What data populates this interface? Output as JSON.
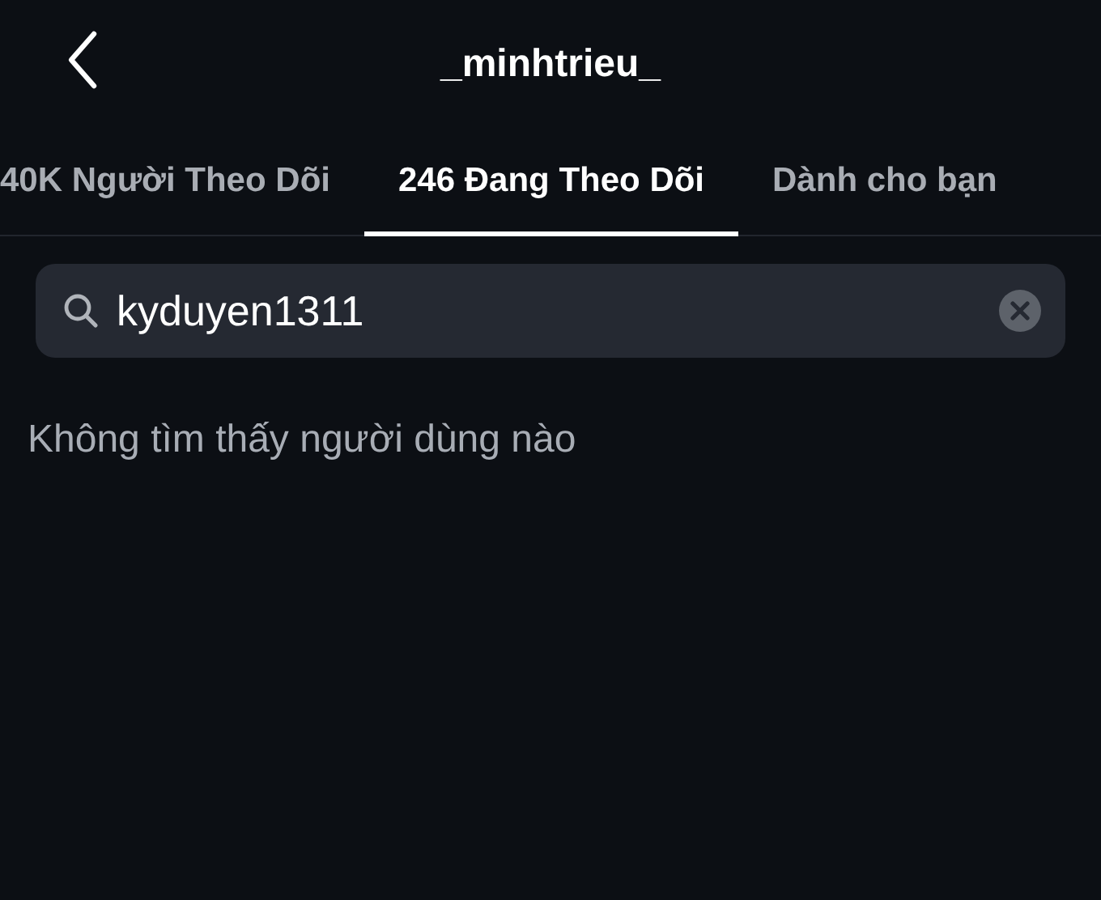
{
  "header": {
    "title": "_minhtrieu_"
  },
  "tabs": [
    {
      "label": "40K Người Theo Dõi",
      "selected": false
    },
    {
      "label": "246 Đang Theo Dõi",
      "selected": true
    },
    {
      "label": "Dành cho bạn",
      "selected": false
    }
  ],
  "search": {
    "value": "kyduyen1311"
  },
  "message": "Không tìm thấy người dùng nào"
}
